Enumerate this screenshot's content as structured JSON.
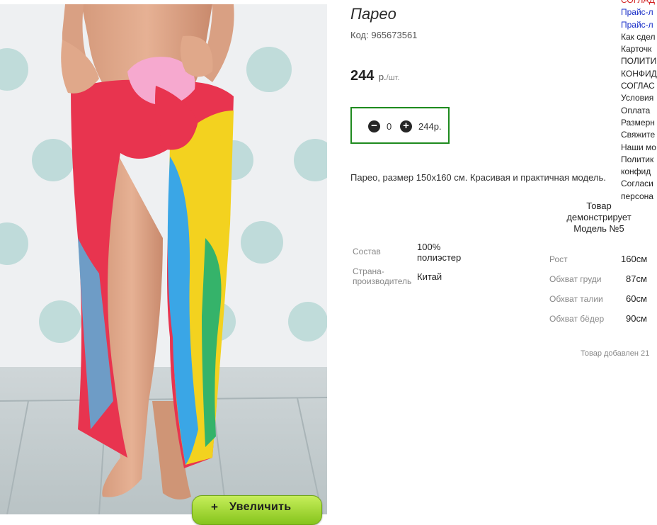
{
  "product": {
    "title": "Парео",
    "code_label": "Код:",
    "code": "965673561",
    "price": "244",
    "currency": "р.",
    "unit": "/шт.",
    "quantity": "0",
    "total": "244р.",
    "description": "Парео, размер 150х160 см. Красивая и практичная модель.",
    "zoom_label": "Увеличить",
    "zoom_icon": "plus-icon"
  },
  "properties": [
    {
      "label": "Состав",
      "value": "100% полиэстер"
    },
    {
      "label": "Страна-производитель",
      "value": "Китай"
    }
  ],
  "model": {
    "title": "Товар демонстрирует Модель №5",
    "params": [
      {
        "label": "Рост",
        "value": "160см"
      },
      {
        "label": "Обхват груди",
        "value": "87см"
      },
      {
        "label": "Обхват талии",
        "value": "60см"
      },
      {
        "label": "Обхват бёдер",
        "value": "90см"
      }
    ]
  },
  "added_text": "Товар добавлен 21",
  "side_links": [
    {
      "text": "СОГЛАД",
      "color": "red"
    },
    {
      "text": "Прайс-л",
      "color": "blue"
    },
    {
      "text": "Прайс-л",
      "color": "blue"
    },
    {
      "text": "Как сдел",
      "color": "dark"
    },
    {
      "text": "Карточк",
      "color": "dark"
    },
    {
      "text": "ПОЛИТИ",
      "color": "dark"
    },
    {
      "text": "КОНФИД",
      "color": "dark"
    },
    {
      "text": "СОГЛАС",
      "color": "dark"
    },
    {
      "text": "Условия",
      "color": "dark"
    },
    {
      "text": "Оплата",
      "color": "dark"
    },
    {
      "text": "Размерн",
      "color": "dark"
    },
    {
      "text": "Свяжите",
      "color": "dark"
    },
    {
      "text": "Наши мо",
      "color": "dark"
    },
    {
      "text": "Политик",
      "color": "dark"
    },
    {
      "text": "конфид",
      "color": "dark"
    },
    {
      "text": "Согласи",
      "color": "dark"
    },
    {
      "text": "персона",
      "color": "dark"
    }
  ],
  "colors": {
    "qty_border": "#1e8a1e",
    "zoom_button": "#9bd42a",
    "link_red": "#d21f1f",
    "link_blue": "#1a2fc8"
  }
}
